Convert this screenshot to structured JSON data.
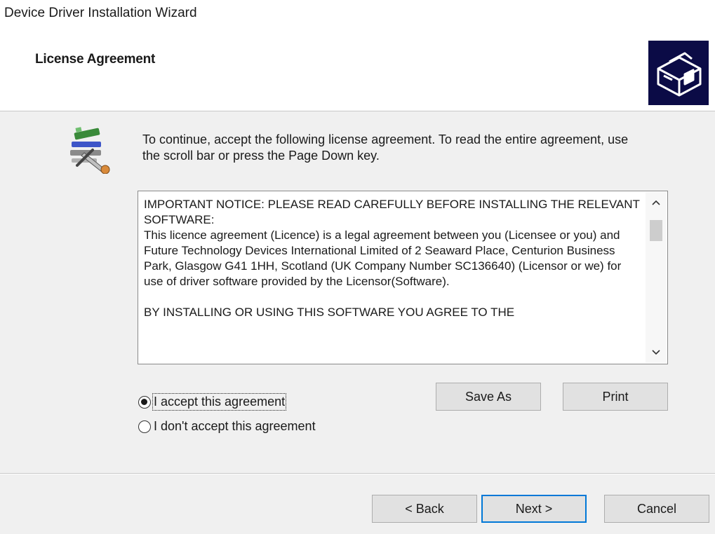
{
  "window": {
    "title": "Device Driver Installation Wizard"
  },
  "header": {
    "page_title": "License Agreement",
    "icon": "install-wizard-icon"
  },
  "content": {
    "icon": "setup-tools-icon",
    "intro_text": "To continue, accept the following license agreement. To read the entire agreement, use the scroll bar or press the Page Down key.",
    "license_text": "IMPORTANT NOTICE: PLEASE READ CAREFULLY BEFORE INSTALLING THE RELEVANT SOFTWARE:\nThis licence agreement (Licence) is a legal agreement between you (Licensee or you) and Future Technology Devices International Limited of 2 Seaward Place, Centurion Business Park, Glasgow G41 1HH, Scotland (UK Company Number SC136640) (Licensor or we) for use of driver software provided by the Licensor(Software).\n\nBY INSTALLING OR USING THIS SOFTWARE YOU AGREE TO THE"
  },
  "options": {
    "accept_label": "I accept this agreement",
    "decline_label": "I don't accept this agreement",
    "selected": "accept"
  },
  "buttons": {
    "save_as": "Save As",
    "print": "Print",
    "back": "< Back",
    "next": "Next >",
    "cancel": "Cancel"
  }
}
